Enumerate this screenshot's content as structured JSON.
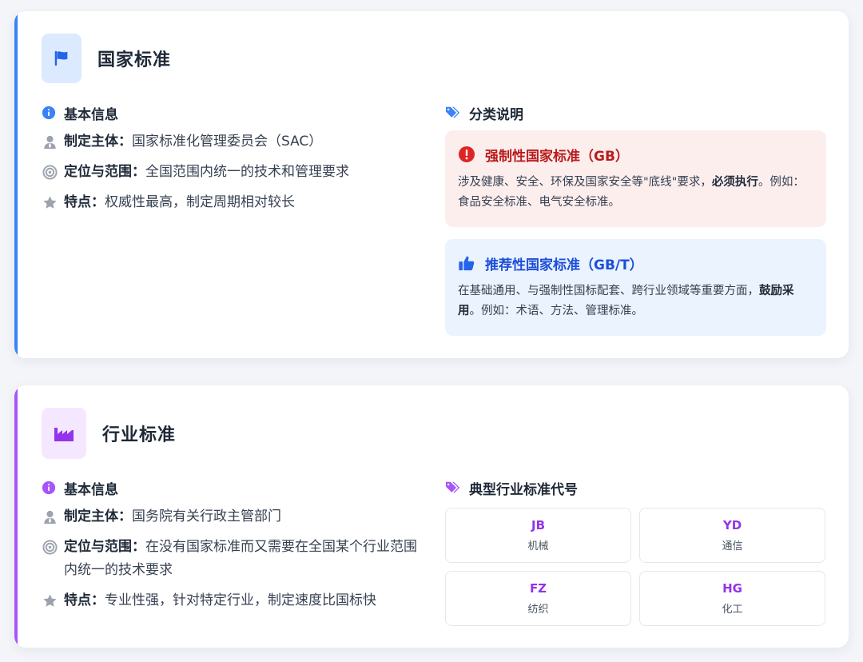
{
  "national": {
    "title": "国家标准",
    "basic_info_title": "基本信息",
    "rows": [
      {
        "key": "制定主体：",
        "value": "国家标准化管理委员会（SAC）"
      },
      {
        "key": "定位与范围：",
        "value": "全国范围内统一的技术和管理要求"
      },
      {
        "key": "特点：",
        "value": "权威性最高，制定周期相对较长"
      }
    ],
    "category_title": "分类说明",
    "mandatory": {
      "title": "强制性国家标准（GB）",
      "body_pre": "涉及健康、安全、环保及国家安全等\"底线\"要求，",
      "body_bold": "必须执行",
      "body_post": "。例如：食品安全标准、电气安全标准。"
    },
    "recommended": {
      "title": "推荐性国家标准（GB/T）",
      "body_pre": "在基础通用、与强制性国标配套、跨行业领域等重要方面，",
      "body_bold": "鼓励采用",
      "body_post": "。例如：术语、方法、管理标准。"
    }
  },
  "industry": {
    "title": "行业标准",
    "basic_info_title": "基本信息",
    "rows": [
      {
        "key": "制定主体：",
        "value": "国务院有关行政主管部门"
      },
      {
        "key": "定位与范围：",
        "value": "在没有国家标准而又需要在全国某个行业范围内统一的技术要求"
      },
      {
        "key": "特点：",
        "value": "专业性强，针对特定行业，制定速度比国标快"
      }
    ],
    "codes_title": "典型行业标准代号",
    "codes": [
      {
        "code": "JB",
        "name": "机械"
      },
      {
        "code": "YD",
        "name": "通信"
      },
      {
        "code": "FZ",
        "name": "纺织"
      },
      {
        "code": "HG",
        "name": "化工"
      }
    ]
  },
  "colors": {
    "blue_accent": "#3b82f6",
    "purple_accent": "#a855f7",
    "red_text": "#b91c1c",
    "blue_text": "#1d4ed8",
    "code_purple": "#9333ea"
  },
  "icons": {
    "national_header": "flag-icon",
    "industry_header": "factory-icon",
    "info": "info-circle-icon",
    "subject": "user-tie-icon",
    "scope": "bullseye-icon",
    "feature": "star-icon",
    "tags": "tags-icon",
    "mandatory": "exclamation-circle-icon",
    "recommended": "thumbs-up-icon"
  }
}
